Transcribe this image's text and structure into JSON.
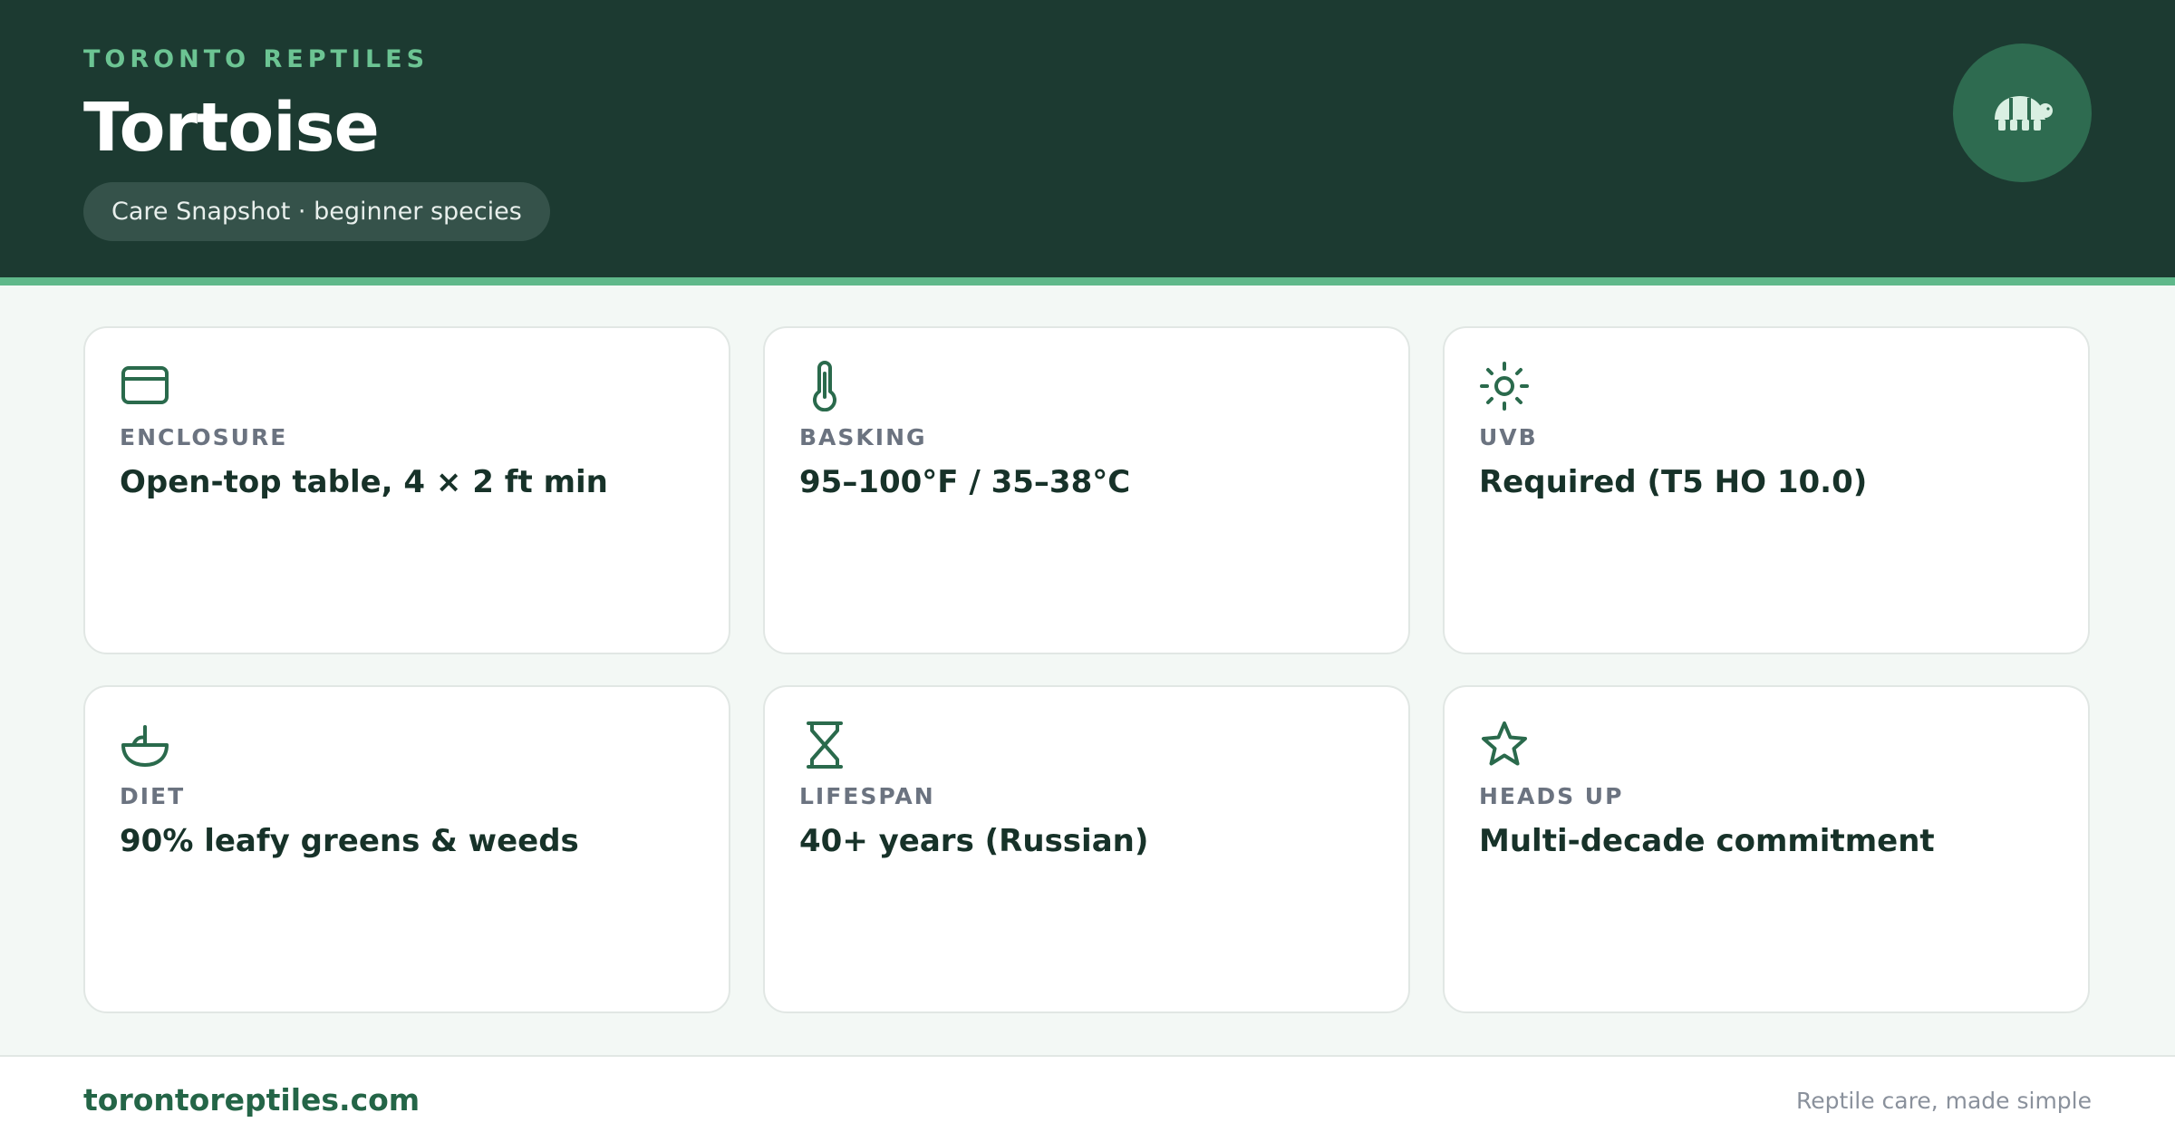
{
  "header": {
    "brand": "TORONTO REPTILES",
    "title": "Tortoise",
    "pill": "Care Snapshot · beginner species",
    "logo_icon": "tortoise-icon"
  },
  "cards": [
    {
      "icon": "enclosure-icon",
      "label": "ENCLOSURE",
      "value": "Open-top table, 4 × 2 ft min"
    },
    {
      "icon": "thermometer-icon",
      "label": "BASKING",
      "value": "95–100°F / 35–38°C"
    },
    {
      "icon": "sun-icon",
      "label": "UVB",
      "value": "Required (T5 HO 10.0)"
    },
    {
      "icon": "bowl-icon",
      "label": "DIET",
      "value": "90% leafy greens & weeds"
    },
    {
      "icon": "hourglass-icon",
      "label": "LIFESPAN",
      "value": "40+ years (Russian)"
    },
    {
      "icon": "star-icon",
      "label": "HEADS UP",
      "value": "Multi-decade commitment"
    }
  ],
  "footer": {
    "site": "torontoreptiles.com",
    "tagline": "Reptile care, made simple"
  },
  "colors": {
    "header_bg": "#1c3a31",
    "accent": "#5fb88a",
    "icon": "#2a6a4c",
    "text_dark": "#173229"
  }
}
